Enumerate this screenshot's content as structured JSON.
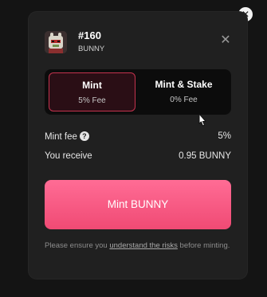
{
  "token": {
    "title": "#160",
    "subtitle": "BUNNY"
  },
  "options": [
    {
      "label": "Mint",
      "fee": "5% Fee",
      "selected": true
    },
    {
      "label": "Mint & Stake",
      "fee": "0% Fee",
      "selected": false
    }
  ],
  "summary": {
    "mint_fee_label": "Mint fee",
    "mint_fee_value": "5%",
    "receive_label": "You receive",
    "receive_value": "0.95 BUNNY"
  },
  "action": {
    "button_label": "Mint BUNNY"
  },
  "disclaimer": {
    "before": "Please ensure you ",
    "link": "understand the risks",
    "after": " before minting."
  },
  "colors": {
    "accent": "#f04a74",
    "selected_border": "#c4334e"
  },
  "icons": {
    "close": "close-icon",
    "help": "question-mark-icon",
    "cursor": "mouse-pointer"
  }
}
